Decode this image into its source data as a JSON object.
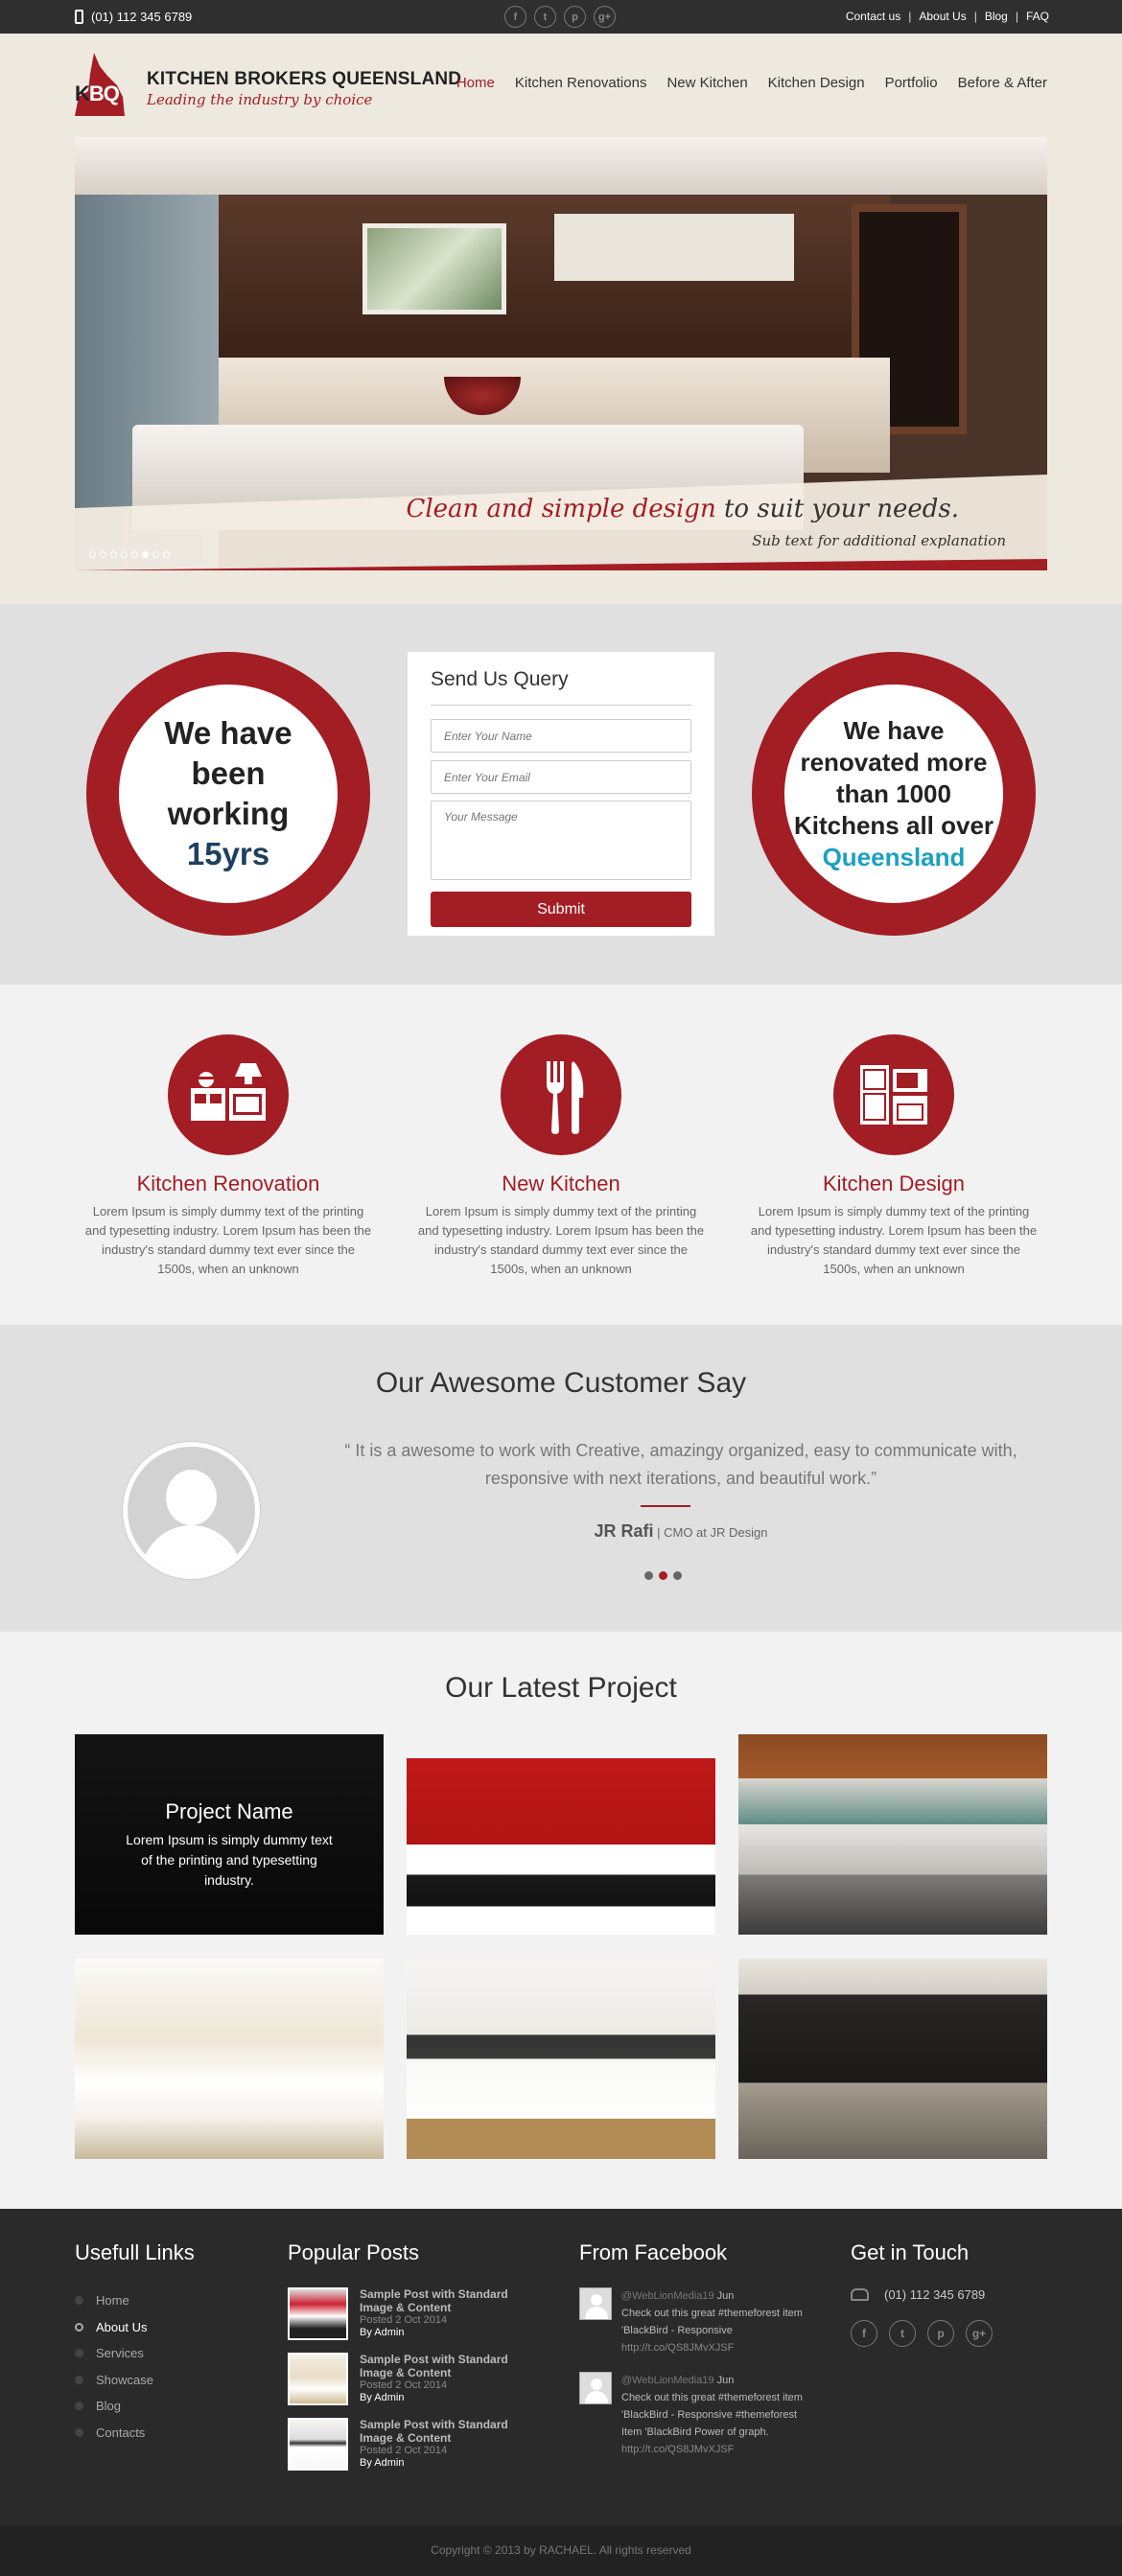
{
  "topbar": {
    "phone": "(01) 112 345 6789",
    "social": [
      "f",
      "t",
      "p",
      "g+"
    ],
    "links": [
      "Contact us",
      "About Us",
      "Blog",
      "FAQ"
    ]
  },
  "logo": {
    "mark": "KBQ",
    "title": "KITCHEN BROKERS QUEENSLAND",
    "tagline": "Leading the industry by choice"
  },
  "nav": [
    "Home",
    "Kitchen Renovations",
    "New Kitchen",
    "Kitchen Design",
    "Portfolio",
    "Before & After"
  ],
  "hero": {
    "caption_highlight": "Clean and simple design",
    "caption_rest": " to suit your needs.",
    "subtext": "Sub text for additional explanation",
    "slides": 8,
    "active_slide": 5
  },
  "badges": {
    "left": {
      "lines": [
        "We have",
        "been",
        "working"
      ],
      "highlight": "15yrs"
    },
    "right": {
      "lines": [
        "We have",
        "renovated more",
        "than 1000",
        "Kitchens all over"
      ],
      "highlight": "Queensland"
    }
  },
  "query_form": {
    "title": "Send Us Query",
    "name_placeholder": "Enter Your Name",
    "email_placeholder": "Enter Your Email",
    "message_placeholder": "Your Message",
    "submit": "Submit"
  },
  "services": [
    {
      "title": "Kitchen Renovation",
      "icon": "kitchen-appliances-icon",
      "text": "Lorem Ipsum is simply dummy text of the printing and typesetting industry. Lorem Ipsum has been the industry's standard dummy text ever since the 1500s, when an unknown"
    },
    {
      "title": "New Kitchen",
      "icon": "fork-knife-icon",
      "text": "Lorem Ipsum is simply dummy text of the printing and typesetting industry. Lorem Ipsum has been the industry's standard dummy text ever since the 1500s, when an unknown"
    },
    {
      "title": "Kitchen Design",
      "icon": "fridge-oven-icon",
      "text": "Lorem Ipsum is simply dummy text of the printing and typesetting industry. Lorem Ipsum has been the industry's standard dummy text ever since the 1500s, when an unknown"
    }
  ],
  "testimonial": {
    "title": "Our Awesome Customer Say",
    "quote": "“ It is a awesome to work with Creative, amazingy organized, easy to communicate with, responsive with next iterations, and beautiful work.”",
    "name": "JR Rafi",
    "role": " | CMO at JR Design",
    "dots": 3,
    "active_dot": 1
  },
  "projects": {
    "title": "Our Latest Project",
    "overlay_name": "Project Name",
    "overlay_text": "Lorem Ipsum is simply dummy text of the printing and typesetting industry."
  },
  "footer": {
    "links_title": "Usefull Links",
    "links": [
      "Home",
      "About Us",
      "Services",
      "Showcase",
      "Blog",
      "Contacts"
    ],
    "active_link": 1,
    "posts_title": "Popular Posts",
    "posts": [
      {
        "title": "Sample Post with Standard Image & Content",
        "date": "Posted 2 Oct 2014",
        "by": "By Admin"
      },
      {
        "title": "Sample Post with Standard Image & Content",
        "date": "Posted 2 Oct 2014",
        "by": "By Admin"
      },
      {
        "title": "Sample Post with Standard Image & Content",
        "date": "Posted 2 Oct 2014",
        "by": "By Admin"
      }
    ],
    "facebook_title": "From Facebook",
    "facebook": [
      {
        "handle": "@WebLionMedia19",
        "time": "Jun",
        "text": "Check out this great #themeforest item 'BlackBird - Responsive",
        "url": "http://t.co/QS8JMvXJSF"
      },
      {
        "handle": "@WebLionMedia19",
        "time": "Jun",
        "text": "Check out this great #themeforest item 'BlackBird - Responsive #themeforest Item 'BlackBird Power of graph.",
        "url": "http://t.co/QS8JMvXJSF"
      }
    ],
    "contact_title": "Get in Touch",
    "contact_phone": "(01) 112 345 6789",
    "social": [
      "f",
      "t",
      "p",
      "g+"
    ]
  },
  "copyright": "Copyright © 2013 by RACHAEL. All rights reserved"
}
